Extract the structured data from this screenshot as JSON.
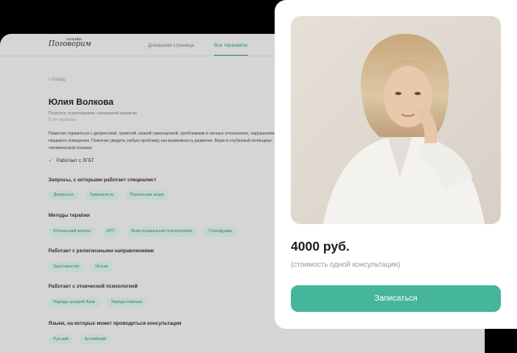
{
  "header": {
    "logo": "Поговорим",
    "logo_small": "онлайн",
    "nav": [
      "Домашняя страница",
      "Все терапевты"
    ]
  },
  "profile": {
    "back_label": "‹  Назад",
    "name": "Юлия Волкова",
    "role": "Психолог, психотерапевт, юнгианский аналитик",
    "experience": "5 лет практики",
    "description": "Помогаю справиться с депрессией, тревогой, низкой самооценкой, проблемами в личных отношениях, нарушениями пищевого поведения. Помогаю увидеть любую проблему как возможность развития. Верю в глубинный потенциал человеческой психики",
    "lgbt": "Работает с ЛГБТ",
    "sections": [
      {
        "title": "Запросы, с которыми работает специалист",
        "chips": [
          "Депрессия",
          "Тревожность",
          "Панические атаки"
        ]
      },
      {
        "title": "Методы терапии",
        "chips": [
          "Юнгианский анализ",
          "КПТ",
          "Экзистенциальная психотерапия",
          "Психодрама"
        ]
      },
      {
        "title": "Работает с религиозными направлениями",
        "chips": [
          "Христианство",
          "Ислам"
        ]
      },
      {
        "title": "Работает с этнической психологией",
        "chips": [
          "Народы средней Азии",
          "Народы Кавказа"
        ]
      },
      {
        "title": "Языки, на которых может проводиться консультация",
        "chips": [
          "Русский",
          "Английский"
        ]
      }
    ]
  },
  "booking": {
    "price": "4000 руб.",
    "price_note": "(стоимость одной консультации)",
    "button_label": "Записаться"
  },
  "colors": {
    "accent": "#45b59c",
    "chip_bg": "#c3d7cf",
    "chip_text": "#3e7e6d"
  }
}
